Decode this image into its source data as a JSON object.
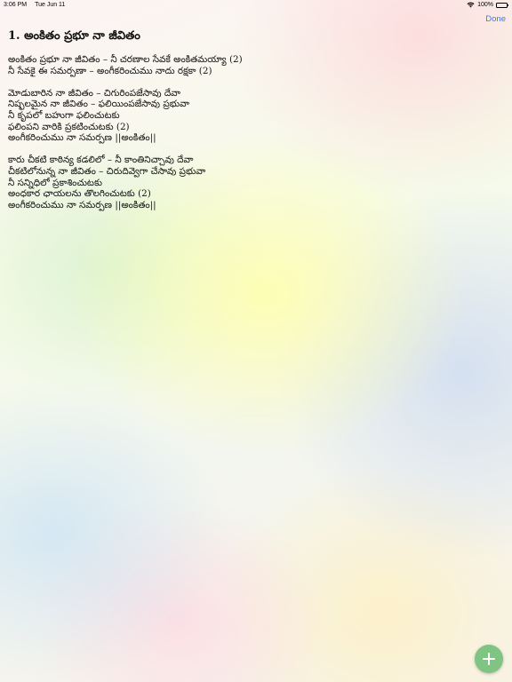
{
  "status_bar": {
    "time": "3:06 PM",
    "date": "Tue Jun 11",
    "battery": "100%",
    "battery_level": 1.0
  },
  "toolbar": {
    "done_label": "Done"
  },
  "song": {
    "title": "1. అంకితం ప్రభూ నా జీవితం",
    "stanzas": [
      [
        "అంకితం ప్రభూ నా జీవితం – నీ చరణాల సేవకే అంకితమయ్యా (2)",
        "నీ సేవకై ఈ సమర్పణా – అంగీకరించుము నాదు రక్షకా (2)"
      ],
      [
        "మోడుబారిన నా జీవితం – చిగురింపజేసావు దేవా",
        "నిష్ఫలమైన నా జీవితం – ఫలియింపజేసావు ప్రభువా",
        "నీ కృపలో బహుగా ఫలించుటకు",
        "ఫలింపని వారికి ప్రకటించుటకు (2)",
        "అంగీకరించుము నా సమర్పణ ||అంకితం||"
      ],
      [
        "కారు చీకటి కాఠిన్య కడలిలో – నీ కాంతినిచ్చావు దేవా",
        "చీకటిలోనున్న నా జీవితం – చిరుదివ్వెగా చేసావు ప్రభువా",
        "నీ సన్నిధిలో ప్రకాశించుటకు",
        "అంధకార ఛాయలను తొలగించుటకు (2)",
        "అంగీకరించుము నా సమర్పణ ||అంకితం||"
      ]
    ]
  },
  "fab": {
    "icon": "plus-icon",
    "color": "#7fc483"
  }
}
